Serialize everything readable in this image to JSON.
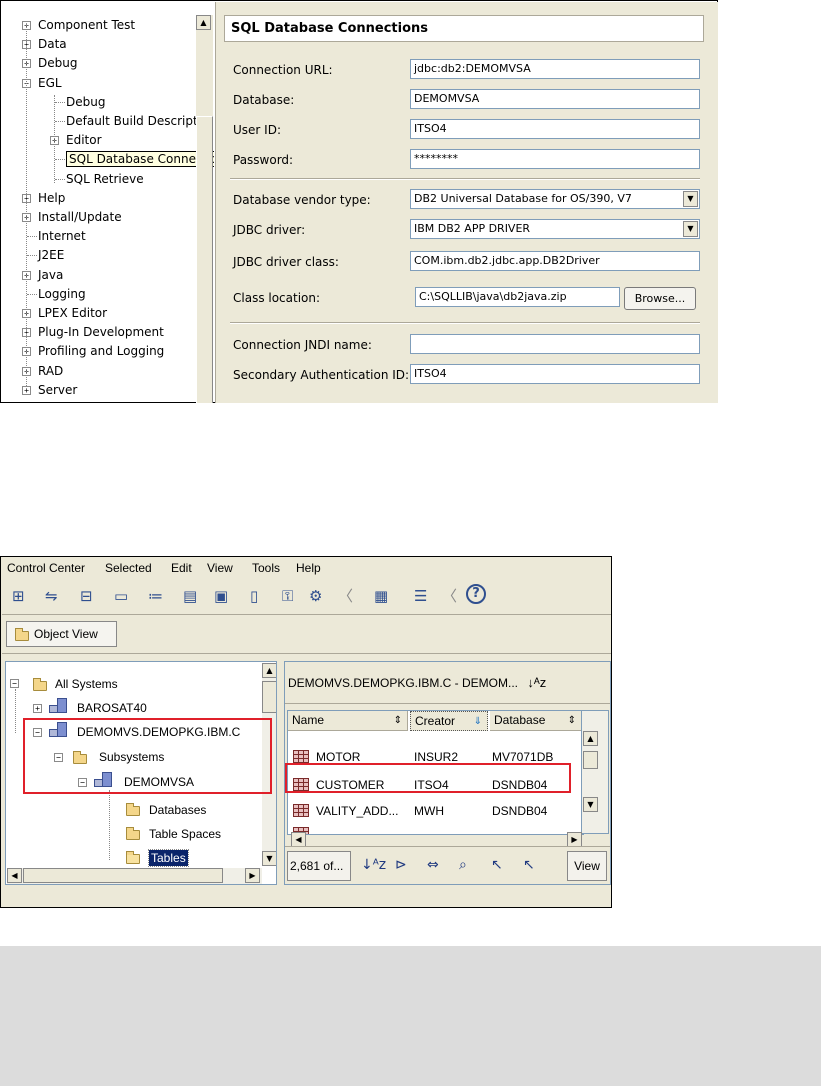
{
  "prefs": {
    "tree": [
      {
        "label": "Component Test",
        "expander": "+"
      },
      {
        "label": "Data",
        "expander": "+"
      },
      {
        "label": "Debug",
        "expander": "+"
      },
      {
        "label": "EGL",
        "expander": "-"
      },
      {
        "label": "Debug",
        "expander": ""
      },
      {
        "label": "Default Build Descriptor",
        "expander": ""
      },
      {
        "label": "Editor",
        "expander": "+"
      },
      {
        "label": "SQL Database Connections",
        "expander": ""
      },
      {
        "label": "SQL Retrieve",
        "expander": ""
      },
      {
        "label": "Help",
        "expander": "+"
      },
      {
        "label": "Install/Update",
        "expander": "+"
      },
      {
        "label": "Internet",
        "expander": ""
      },
      {
        "label": "J2EE",
        "expander": ""
      },
      {
        "label": "Java",
        "expander": "+"
      },
      {
        "label": "Logging",
        "expander": ""
      },
      {
        "label": "LPEX Editor",
        "expander": "+"
      },
      {
        "label": "Plug-In Development",
        "expander": "+"
      },
      {
        "label": "Profiling and Logging",
        "expander": "+"
      },
      {
        "label": "RAD",
        "expander": "+"
      },
      {
        "label": "Server",
        "expander": "+"
      }
    ],
    "title": "SQL Database Connections",
    "fields": {
      "connection_url": {
        "label": "Connection URL:",
        "value": "jdbc:db2:DEMOMVSA"
      },
      "database": {
        "label": "Database:",
        "value": "DEMOMVSA"
      },
      "user_id": {
        "label": "User ID:",
        "value": "ITSO4"
      },
      "password": {
        "label": "Password:",
        "value": "********"
      },
      "vendor": {
        "label": "Database vendor type:",
        "value": "DB2 Universal Database for OS/390, V7"
      },
      "driver": {
        "label": "JDBC driver:",
        "value": "IBM DB2 APP DRIVER"
      },
      "driver_class": {
        "label": "JDBC driver class:",
        "value": "COM.ibm.db2.jdbc.app.DB2Driver"
      },
      "class_location": {
        "label": "Class location:",
        "value": "C:\\SQLLIB\\java\\db2java.zip"
      },
      "jndi": {
        "label": "Connection JNDI name:",
        "value": ""
      },
      "secondary_auth": {
        "label": "Secondary Authentication ID:",
        "value": "ITSO4"
      }
    },
    "browse_label": "Browse..."
  },
  "control_center": {
    "menu": [
      "Control Center",
      "Selected",
      "Edit",
      "View",
      "Tools",
      "Help"
    ],
    "object_view_label": "Object View",
    "tree": {
      "all_systems": "All Systems",
      "barosat": "BAROSAT40",
      "demomvs": "DEMOMVS.DEMOPKG.IBM.C",
      "subsystems": "Subsystems",
      "demomvsa": "DEMOMVSA",
      "databases": "Databases",
      "table_spaces": "Table Spaces",
      "tables": "Tables"
    },
    "right_title": "DEMOMVS.DEMOPKG.IBM.C - DEMOM...",
    "columns": [
      "Name",
      "Creator",
      "Database"
    ],
    "rows": [
      {
        "name": "MOTOR",
        "creator": "INSUR2",
        "database": "MV7071DB"
      },
      {
        "name": "CUSTOMER",
        "creator": "ITSO4",
        "database": "DSNDB04"
      },
      {
        "name": "VALITY_ADD...",
        "creator": "MWH",
        "database": "DSNDB04"
      }
    ],
    "count_label": "2,681 of...",
    "view_label": "View"
  }
}
